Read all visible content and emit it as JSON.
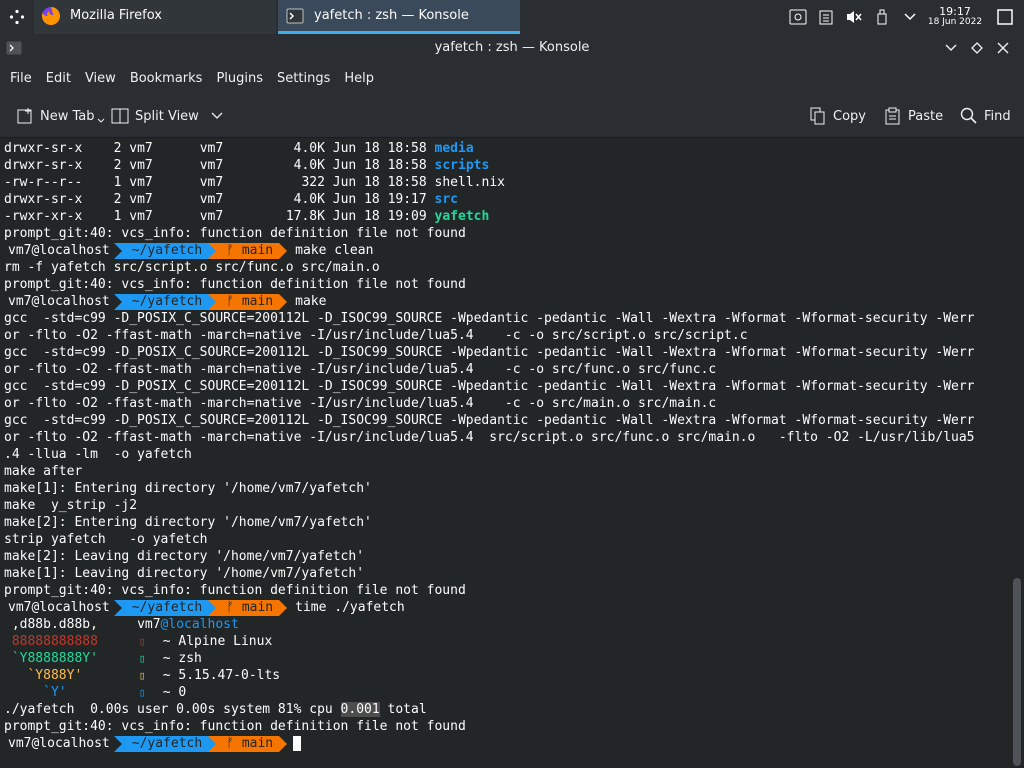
{
  "taskbar": {
    "tasks": [
      {
        "label": "Mozilla Firefox"
      },
      {
        "label": "yafetch : zsh — Konsole"
      }
    ],
    "clock": {
      "time": "19:17",
      "date": "18 Jun 2022"
    }
  },
  "window": {
    "title": "yafetch : zsh — Konsole"
  },
  "menu": [
    "File",
    "Edit",
    "View",
    "Bookmarks",
    "Plugins",
    "Settings",
    "Help"
  ],
  "toolbar": {
    "new_tab": "New Tab",
    "split_view": "Split View",
    "copy": "Copy",
    "paste": "Paste",
    "find": "Find"
  },
  "prompt": {
    "user": "vm7@localhost",
    "path": "~/yafetch",
    "branch": "ᚠ main"
  },
  "terminal": {
    "ls_rows": [
      {
        "perm": "drwxr-sr-x",
        "links": "2",
        "user": "vm7",
        "group": "vm7",
        "size": "4.0K",
        "date": "Jun 18 18:58",
        "name": "media"
      },
      {
        "perm": "drwxr-sr-x",
        "links": "2",
        "user": "vm7",
        "group": "vm7",
        "size": "4.0K",
        "date": "Jun 18 18:58",
        "name": "scripts"
      },
      {
        "perm": "-rw-r--r--",
        "links": "1",
        "user": "vm7",
        "group": "vm7",
        "size": "322",
        "date": "Jun 18 18:58",
        "name": "shell.nix"
      },
      {
        "perm": "drwxr-sr-x",
        "links": "2",
        "user": "vm7",
        "group": "vm7",
        "size": "4.0K",
        "date": "Jun 18 19:17",
        "name": "src"
      },
      {
        "perm": "-rwxr-xr-x",
        "links": "1",
        "user": "vm7",
        "group": "vm7",
        "size": "17.8K",
        "date": "Jun 18 19:09",
        "name": "yafetch"
      }
    ],
    "vcs_err": "prompt_git:40: vcs_info: function definition file not found",
    "cmd_clean": "make clean",
    "rm_line": "rm -f yafetch src/script.o src/func.o src/main.o",
    "cmd_make": "make",
    "gcc1a": "gcc  -std=c99 -D_POSIX_C_SOURCE=200112L -D_ISOC99_SOURCE -Wpedantic -pedantic -Wall -Wextra -Wformat -Wformat-security -Werr",
    "gcc1b": "or -flto -O2 -ffast-math -march=native -I/usr/include/lua5.4    -c -o src/script.o src/script.c",
    "gcc2b": "or -flto -O2 -ffast-math -march=native -I/usr/include/lua5.4    -c -o src/func.o src/func.c",
    "gcc3b": "or -flto -O2 -ffast-math -march=native -I/usr/include/lua5.4    -c -o src/main.o src/main.c",
    "gcc4b": "or -flto -O2 -ffast-math -march=native -I/usr/include/lua5.4  src/script.o src/func.o src/main.o   -flto -O2 -L/usr/lib/lua5",
    "gcc4c": ".4 -llua -lm  -o yafetch",
    "make_after": "make after",
    "make1_enter": "make[1]: Entering directory '/home/vm7/yafetch'",
    "make_strip": "make  y_strip -j2",
    "make2_enter": "make[2]: Entering directory '/home/vm7/yafetch'",
    "strip_line": "strip yafetch   -o yafetch",
    "make2_leave": "make[2]: Leaving directory '/home/vm7/yafetch'",
    "make1_leave": "make[1]: Leaving directory '/home/vm7/yafetch'",
    "cmd_time": "time ./yafetch",
    "logo": [
      ",d88b.d88b,",
      "88888888888",
      "`Y8888888Y'",
      "`Y888Y'",
      "`Y'"
    ],
    "fetch_user": "vm7",
    "fetch_host": "@localhost",
    "fetch_rows": [
      "~ Alpine Linux",
      "~ zsh",
      "~ 5.15.47-0-lts",
      "~ 0"
    ],
    "time_pre": "./yafetch  0.00s user 0.00s system 81% cpu ",
    "time_hl": "0.001",
    "time_post": " total"
  }
}
